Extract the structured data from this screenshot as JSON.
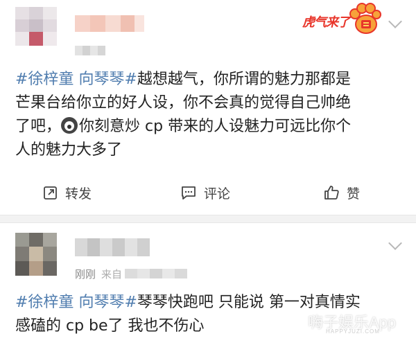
{
  "post1": {
    "badge_text": "虎气来了",
    "text_parts": {
      "tag1": "#徐梓童",
      "tag2": "向琴琴#",
      "line1_rest": "越想越气，你所谓的魅力那都是",
      "line2": "芒果台给你立的好人设，你不会真的觉得自己帅绝",
      "line3_a": "了吧，",
      "line3_b": "你刻意炒 cp 带来的人设魅力可远比你个",
      "line4": "人的魅力大多了"
    },
    "actions": {
      "repost": "转发",
      "comment": "评论",
      "like": "赞"
    }
  },
  "post2": {
    "time_text": "刚刚",
    "source_text": "来自",
    "text_parts": {
      "tag1": "#徐梓童",
      "tag2": "向琴琴#",
      "line1_rest": "琴琴快跑吧 只能说 第一对真情实",
      "line2": "感磕的 cp be了 我也不伤心"
    }
  },
  "watermark": {
    "main": "嗨子娱乐App",
    "sub": "HAPPYJUZI.COM"
  },
  "colors": {
    "tag": "#507daf",
    "badge": "#e8352a",
    "divider": "#f2f2f2"
  },
  "icons": [
    "chevron-down-icon",
    "repost-icon",
    "comment-icon",
    "like-icon",
    "emoji-icon",
    "tiger-paw-icon"
  ]
}
